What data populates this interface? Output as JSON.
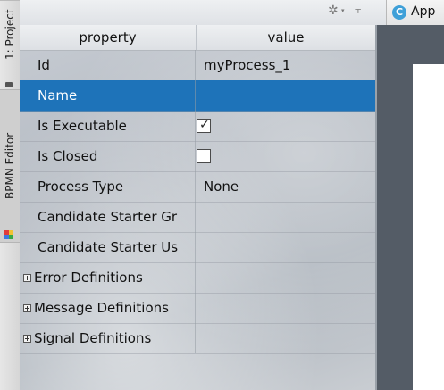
{
  "side_panel": {
    "project_tab": "1: Project",
    "bpmn_tab": "BPMN Editor"
  },
  "toolbar": {
    "editor_tab_label": "App",
    "editor_tab_icon": "C"
  },
  "properties": {
    "header_property": "property",
    "header_value": "value",
    "rows": [
      {
        "name": "Id",
        "value": "myProcess_1"
      },
      {
        "name": "Name",
        "value": ""
      },
      {
        "name": "Is Executable",
        "checked": true
      },
      {
        "name": "Is Closed",
        "checked": false
      },
      {
        "name": "Process Type",
        "value": "None"
      },
      {
        "name": "Candidate Starter Gr",
        "value": ""
      },
      {
        "name": "Candidate Starter Us",
        "value": ""
      },
      {
        "name": "Error Definitions",
        "value": ""
      },
      {
        "name": "Message Definitions",
        "value": ""
      },
      {
        "name": "Signal Definitions",
        "value": ""
      }
    ],
    "selected_row": "Name"
  },
  "colors": {
    "selection": "#1e73b9",
    "canvas_bg": "#545c66",
    "editor_icon": "#3fa0d8"
  }
}
